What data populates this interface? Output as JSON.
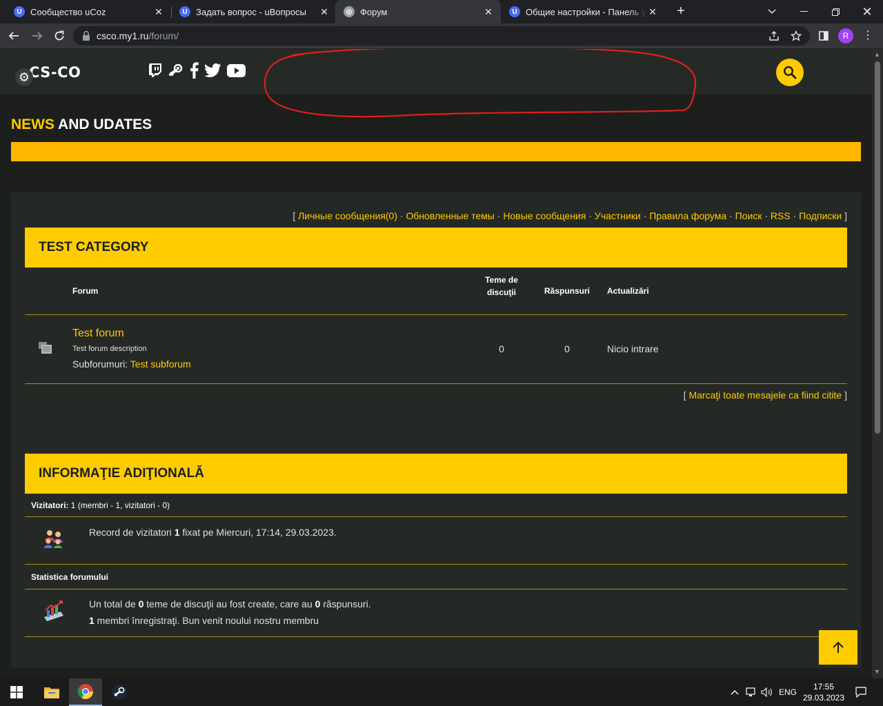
{
  "browser": {
    "tabs": [
      {
        "title": "Сообщество uCoz",
        "favicon": "U"
      },
      {
        "title": "Задать вопрос - uВопросы",
        "favicon": "U"
      },
      {
        "title": "Форум",
        "favicon": "forum-icon"
      },
      {
        "title": "Общие настройки - Панель управления",
        "favicon": "U"
      }
    ],
    "active_tab": 2,
    "url_host": "csco.my1.ru",
    "url_path": "/forum/",
    "profile_initial": "R"
  },
  "site": {
    "logo": "CS-CO",
    "social": [
      "twitch-icon",
      "steam-icon",
      "facebook-icon",
      "twitter-icon",
      "youtube-icon"
    ],
    "news_title_accent": "NEWS",
    "news_title_rest": " AND UDATES",
    "accent_color": "#ffcc00",
    "news_bar_color": "#ffb700"
  },
  "forum": {
    "toplinks": [
      "Личные сообщения(0)",
      "Обновленные темы",
      "Новые сообщения",
      "Участники",
      "Правила форума",
      "Поиск",
      "RSS",
      "Подписки"
    ],
    "category_title": "TEST CATEGORY",
    "columns": {
      "forum": "Forum",
      "topics_line1": "Teme de",
      "topics_line2": "discuţii",
      "replies": "Răspunsuri",
      "updates": "Actualizări"
    },
    "rows": [
      {
        "name": "Test forum",
        "description": "Test forum description",
        "subforum_label": "Subforumuri:",
        "subforum_link": "Test subforum",
        "topics": "0",
        "replies": "0",
        "last_post": "Nicio intrare"
      }
    ],
    "mark_read": "Marcaţi toate mesajele ca fiind citite"
  },
  "info": {
    "title": "INFORMAŢIE ADIŢIONALĂ",
    "visitors_label": "Vizitatori:",
    "visitors_detail": " 1 (membri - 1, vizitatori - 0)",
    "record_prefix": "Record de vizitatori ",
    "record_count": "1",
    "record_suffix": " fixat pe Miercuri, 17:14, 29.03.2023.",
    "stats_label": "Statistica forumului",
    "stats_prefix": "Un total de ",
    "stats_topics": "0",
    "stats_mid": " teme de discuţii au fost create, care au ",
    "stats_replies": "0",
    "stats_suffix": " răspunsuri.",
    "members_count": "1",
    "members_text": " membri înregistraţi. Bun venit noului nostru membru"
  },
  "taskbar": {
    "apps": [
      "windows-start-icon",
      "file-explorer-icon",
      "chrome-icon",
      "steam-icon"
    ],
    "language": "ENG",
    "time": "17:55",
    "date": "29.03.2023"
  }
}
